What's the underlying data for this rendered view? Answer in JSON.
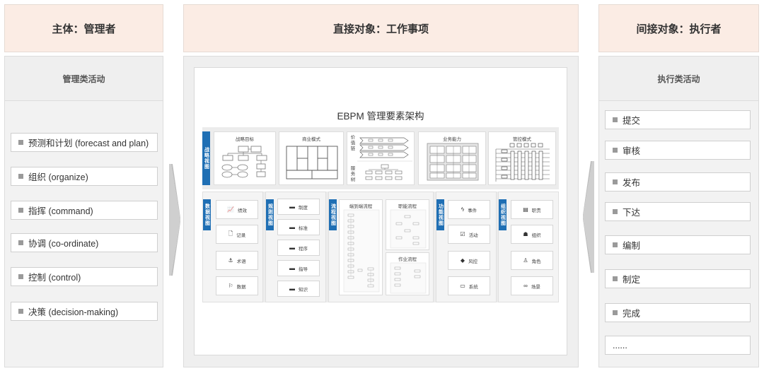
{
  "headers": {
    "left": "主体：管理者",
    "middle": "直接对象：工作事项",
    "right": "间接对象：执行者"
  },
  "left_column": {
    "title": "管理类活动",
    "items": [
      "预测和计划 (forecast and plan)",
      "组织 (organize)",
      "指挥 (command)",
      "协调 (co-ordinate)",
      "控制 (control)",
      "决策 (decision-making)"
    ]
  },
  "right_column": {
    "title": "执行类活动",
    "items": [
      "提交",
      "审核",
      "发布",
      "下达",
      "编制",
      "制定",
      "完成",
      "......"
    ]
  },
  "ebpm": {
    "title": "EBPM 管理要素架构",
    "strategy": {
      "tab": "战略视图",
      "cards": {
        "goal": "战略目标",
        "business_model": "商业模式",
        "value_chain": "价值链",
        "service_tree": "服务树",
        "capability": "业务能力",
        "control_mode": "管控模式"
      }
    },
    "data_view": {
      "tab": "数据视图",
      "items": [
        "绩效",
        "记录",
        "术语",
        "数据"
      ],
      "icons": [
        "chart-line-icon",
        "document-icon",
        "anchor-icon",
        "flag-icon"
      ]
    },
    "rule_view": {
      "tab": "规则视图",
      "items": [
        "制度",
        "标准",
        "程序",
        "指导",
        "知识"
      ],
      "icons": [
        "book-icon",
        "book-icon",
        "book-icon",
        "book-icon",
        "book-icon"
      ]
    },
    "process_view": {
      "tab": "流程视图",
      "e2e": "端到端流程",
      "functional": "职能流程",
      "job": "作业流程"
    },
    "function_view": {
      "tab": "功能视图",
      "items": [
        "事件",
        "活动",
        "风控",
        "系统"
      ],
      "icons": [
        "lightning-icon",
        "checkbox-icon",
        "tag-icon",
        "monitor-icon"
      ]
    },
    "org_view": {
      "tab": "组织视图",
      "items": [
        "职责",
        "组织",
        "角色",
        "场景"
      ],
      "icons": [
        "id-card-icon",
        "org-chart-icon",
        "person-icon",
        "link-icon"
      ]
    }
  },
  "colors": {
    "header_bg": "#fbece4",
    "panel_bg": "#efefef",
    "accent_blue": "#1f6fb4"
  }
}
